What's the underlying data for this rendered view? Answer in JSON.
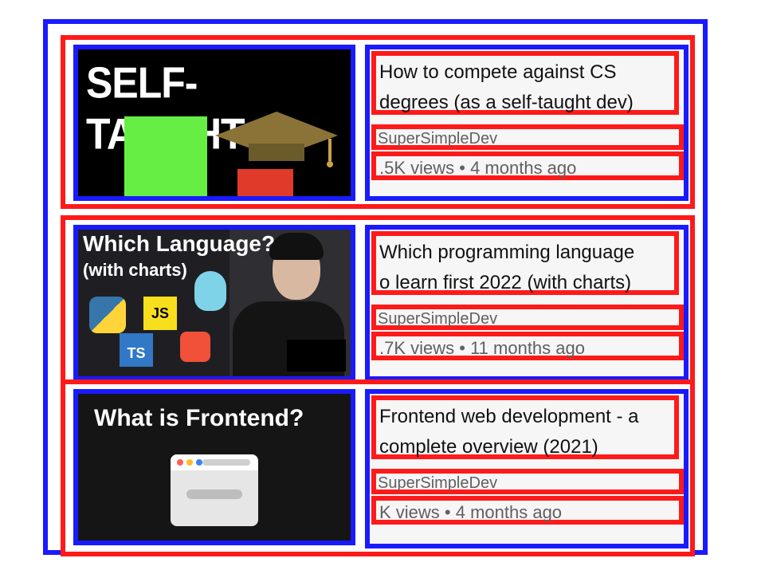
{
  "videos": [
    {
      "title_line1": "How to compete against CS",
      "title_line2": "degrees (as a self-taught dev)",
      "channel": "SuperSimpleDev",
      "stats": ".5K views • 4 months ago",
      "thumbnail_text": "SELF-TAUGHT"
    },
    {
      "title_line1": "Which programming language",
      "title_line2": "o learn first 2022 (with charts)",
      "channel": "SuperSimpleDev",
      "stats": ".7K views • 11 months ago",
      "thumbnail_text1": "Which Language?",
      "thumbnail_text2": "(with charts)",
      "logos": [
        "python-logo",
        "js-logo",
        "go-logo",
        "ts-logo",
        "swift-logo"
      ]
    },
    {
      "title_line1": "Frontend web development - a",
      "title_line2": "complete overview (2021)",
      "channel": "SuperSimpleDev",
      "stats": "K views • 4 months ago",
      "thumbnail_text": "What is Frontend?"
    }
  ],
  "logo_text": {
    "js": "JS",
    "ts": "TS"
  },
  "colors": {
    "outline_blue": "#1a1aff",
    "outline_red": "#ff1a1a",
    "green": "#66ee44",
    "red": "#e03a2a"
  }
}
